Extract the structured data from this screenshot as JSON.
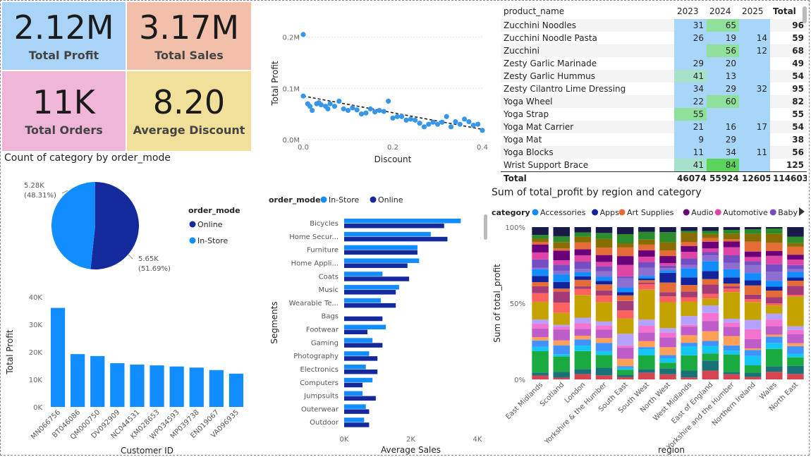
{
  "kpis": [
    {
      "value": "2.12M",
      "label": "Total Profit",
      "color": "#a9d3f7"
    },
    {
      "value": "3.17M",
      "label": "Total Sales",
      "color": "#f2c0aa"
    },
    {
      "value": "11K",
      "label": "Total Orders",
      "color": "#efb6d8"
    },
    {
      "value": "8.20",
      "label": "Average Discount",
      "color": "#f0e099"
    }
  ],
  "scatter": {
    "chart_data": {
      "type": "scatter",
      "xlabel": "Discount",
      "ylabel": "Total Profit",
      "x_ticks": [
        "0.0",
        "0.2",
        "0.4"
      ],
      "y_ticks": [
        "0.0M",
        "0.1M",
        "0.2M"
      ],
      "xlim": [
        0,
        0.4
      ],
      "ylim": [
        0,
        0.22
      ],
      "points": [
        [
          0.0,
          0.205
        ],
        [
          0.0,
          0.085
        ],
        [
          0.01,
          0.07
        ],
        [
          0.015,
          0.065
        ],
        [
          0.02,
          0.057
        ],
        [
          0.03,
          0.07
        ],
        [
          0.035,
          0.072
        ],
        [
          0.04,
          0.068
        ],
        [
          0.05,
          0.065
        ],
        [
          0.055,
          0.06
        ],
        [
          0.06,
          0.07
        ],
        [
          0.07,
          0.065
        ],
        [
          0.08,
          0.075
        ],
        [
          0.09,
          0.06
        ],
        [
          0.1,
          0.057
        ],
        [
          0.11,
          0.062
        ],
        [
          0.12,
          0.058
        ],
        [
          0.13,
          0.05
        ],
        [
          0.14,
          0.052
        ],
        [
          0.15,
          0.06
        ],
        [
          0.16,
          0.054
        ],
        [
          0.17,
          0.057
        ],
        [
          0.18,
          0.055
        ],
        [
          0.19,
          0.075
        ],
        [
          0.2,
          0.042
        ],
        [
          0.21,
          0.045
        ],
        [
          0.22,
          0.045
        ],
        [
          0.23,
          0.038
        ],
        [
          0.24,
          0.04
        ],
        [
          0.25,
          0.038
        ],
        [
          0.26,
          0.032
        ],
        [
          0.27,
          0.025
        ],
        [
          0.28,
          0.03
        ],
        [
          0.29,
          0.034
        ],
        [
          0.3,
          0.03
        ],
        [
          0.31,
          0.034
        ],
        [
          0.32,
          0.045
        ],
        [
          0.33,
          0.025
        ],
        [
          0.34,
          0.035
        ],
        [
          0.35,
          0.03
        ],
        [
          0.36,
          0.04
        ],
        [
          0.37,
          0.035
        ],
        [
          0.38,
          0.028
        ],
        [
          0.39,
          0.03
        ],
        [
          0.4,
          0.018
        ]
      ],
      "trendline": [
        [
          0,
          0.085
        ],
        [
          0.4,
          0.02
        ]
      ],
      "color": "#3896e8"
    }
  },
  "table": {
    "headers": [
      "product_name",
      "2023",
      "2024",
      "2025",
      "Total"
    ],
    "rows": [
      [
        "Zucchini Noodles",
        "31",
        "65",
        "",
        "96"
      ],
      [
        "Zucchini Noodle Pasta",
        "26",
        "19",
        "14",
        "59"
      ],
      [
        "Zucchini",
        "",
        "56",
        "12",
        "68"
      ],
      [
        "Zesty Garlic Marinade",
        "29",
        "20",
        "",
        "49"
      ],
      [
        "Zesty Garlic Hummus",
        "41",
        "13",
        "",
        "54"
      ],
      [
        "Zesty Cilantro Lime Dressing",
        "34",
        "29",
        "32",
        "95"
      ],
      [
        "Yoga Wheel",
        "22",
        "60",
        "",
        "82"
      ],
      [
        "Yoga Strap",
        "55",
        "",
        "",
        "55"
      ],
      [
        "Yoga Mat Carrier",
        "21",
        "16",
        "17",
        "54"
      ],
      [
        "Yoga Mat",
        "9",
        "29",
        "",
        "38"
      ],
      [
        "Yoga Blocks",
        "11",
        "34",
        "11",
        "56"
      ],
      [
        "Wrist Support Brace",
        "41",
        "84",
        "",
        "125"
      ]
    ],
    "total": [
      "Total",
      "46074",
      "55924",
      "12605",
      "114603"
    ]
  },
  "pie": {
    "title": "Count of category by order_mode",
    "legend_title": "order_mode",
    "chart_data": {
      "type": "pie",
      "slices": [
        {
          "name": "Online",
          "value": 5.65,
          "label": "5.65K",
          "pct": "(51.69%)",
          "color": "#14299c"
        },
        {
          "name": "In-Store",
          "value": 5.28,
          "label": "5.28K",
          "pct": "(48.31%)",
          "color": "#118dff"
        }
      ]
    }
  },
  "customers": {
    "chart_data": {
      "type": "bar",
      "xlabel": "Customer ID",
      "ylabel": "Total Profit",
      "categories": [
        "MN066756",
        "BT046086",
        "QM000750",
        "DV092909",
        "NC044531",
        "KM028653",
        "WP034593",
        "MP039738",
        "EN019067",
        "VA096935"
      ],
      "values": [
        36000,
        19200,
        18500,
        15900,
        15400,
        15100,
        14700,
        14300,
        13400,
        12100
      ],
      "ylim": [
        0,
        40000
      ],
      "y_ticks": [
        "0K",
        "10K",
        "20K",
        "30K",
        "40K"
      ],
      "color": "#118dff"
    }
  },
  "segments": {
    "legend_title": "order_mode",
    "chart_data": {
      "type": "bar",
      "xlabel": "Average Sales",
      "ylabel": "Segments",
      "categories": [
        "Bicycles",
        "Home Secur...",
        "Furniture",
        "Home Appli...",
        "Coats",
        "Music",
        "Wearable Te...",
        "Bags",
        "Footwear",
        "Gaming",
        "Photography",
        "Electronics",
        "Computers",
        "Jumpsuits",
        "Outerwear",
        "Outdoor"
      ],
      "series": [
        {
          "name": "In-Store",
          "color": "#118dff",
          "values": [
            3500,
            2600,
            2200,
            2250,
            1150,
            1650,
            1100,
            0,
            1250,
            850,
            750,
            650,
            850,
            550,
            650,
            600
          ]
        },
        {
          "name": "Online",
          "color": "#14299c",
          "values": [
            3000,
            3100,
            2200,
            1900,
            1950,
            1550,
            1550,
            1150,
            700,
            1150,
            1000,
            1000,
            550,
            950,
            750,
            750
          ]
        }
      ],
      "xlim": [
        0,
        4000
      ],
      "x_ticks": [
        "0K",
        "2K",
        "4K"
      ]
    }
  },
  "stacked": {
    "title": "Sum of total_profit by region and category",
    "legend_title": "category",
    "legend": [
      {
        "name": "Accessories",
        "color": "#118dff"
      },
      {
        "name": "Apps",
        "color": "#12239e"
      },
      {
        "name": "Art Supplies",
        "color": "#e66c37"
      },
      {
        "name": "Audio",
        "color": "#6b007b"
      },
      {
        "name": "Automotive",
        "color": "#e044a7"
      },
      {
        "name": "Baby",
        "color": "#744ec2"
      }
    ],
    "chart_data": {
      "type": "bar",
      "stacked": "100%",
      "xlabel": "region",
      "ylabel": "Sum of total_profit",
      "y_ticks": [
        "0%",
        "50%",
        "100%"
      ],
      "categories": [
        "East Midlands",
        "Scotland",
        "London",
        "Yorkshire & the Humber",
        "South East",
        "South West",
        "North West",
        "West Midlands",
        "East of England",
        "Yorkshire and the Humber",
        "Northern Ireland",
        "Wales",
        "North East"
      ],
      "segment_colors": [
        "#d64550",
        "#197278",
        "#1aab40",
        "#15c6f4",
        "#4092ff",
        "#ffa058",
        "#be5dc9",
        "#f472d0",
        "#b5a1ff",
        "#c4a200",
        "#fd625e",
        "#a43b76",
        "#e66c37",
        "#12239e",
        "#118dff",
        "#8d6fd1",
        "#744ec2",
        "#e044a7",
        "#6b007b",
        "#e66c37",
        "#8a6d00",
        "#2a8c2a",
        "#1a1a4a"
      ]
    }
  }
}
